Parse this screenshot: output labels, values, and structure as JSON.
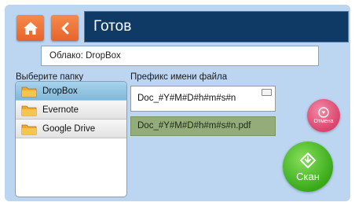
{
  "header": {
    "title": "Готов",
    "home_icon": "home-icon",
    "back_icon": "chevron-left-icon"
  },
  "cloud": {
    "label": "Облако: DropBox"
  },
  "folders": {
    "label": "Выберите папку",
    "items": [
      {
        "label": "DropBox",
        "icon": "folder-icon",
        "selected": true
      },
      {
        "label": "Evernote",
        "icon": "folder-icon",
        "selected": false
      },
      {
        "label": "Google Drive",
        "icon": "folder-icon",
        "selected": false
      }
    ]
  },
  "prefix": {
    "label": "Префикс имени файла",
    "value": "Doc_#Y#M#D#h#m#s#n",
    "keyboard_icon": "keyboard-icon"
  },
  "preview": {
    "value": "Doc_#Y#M#D#h#m#s#n.pdf"
  },
  "actions": {
    "cancel_label": "Отмена",
    "scan_label": "Скан"
  },
  "colors": {
    "accent_orange": "#e8642a",
    "title_bar": "#0f3a66",
    "panel": "#bcd6f2",
    "selected_row": "#8cc2e2",
    "preview_bg": "#94ac7a",
    "cancel": "#d9436b",
    "scan": "#37a818"
  }
}
